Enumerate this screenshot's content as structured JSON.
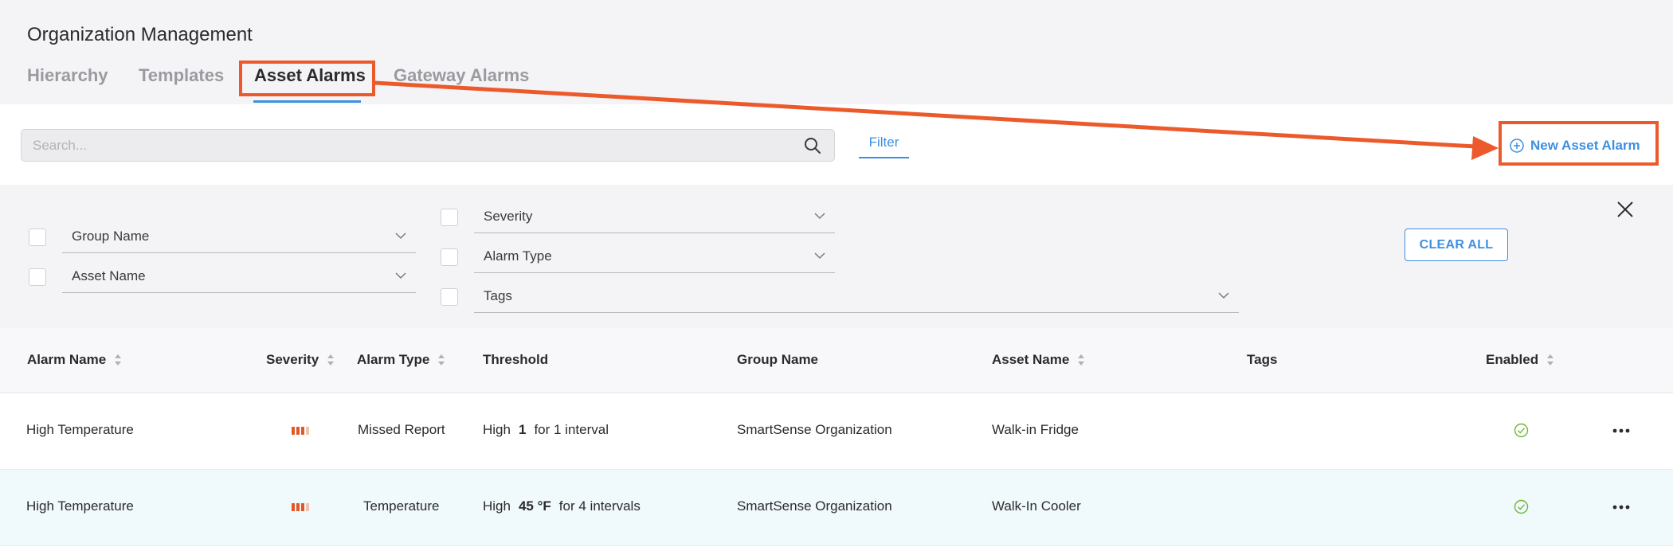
{
  "page": {
    "title": "Organization Management"
  },
  "tabs": [
    {
      "label": "Hierarchy",
      "active": false
    },
    {
      "label": "Templates",
      "active": false
    },
    {
      "label": "Asset Alarms",
      "active": true
    },
    {
      "label": "Gateway Alarms",
      "active": false
    }
  ],
  "toolbar": {
    "search_placeholder": "Search...",
    "filter_label": "Filter",
    "new_button_label": "New Asset Alarm"
  },
  "filters": {
    "group_name": "Group Name",
    "asset_name": "Asset Name",
    "severity": "Severity",
    "alarm_type": "Alarm Type",
    "tags": "Tags",
    "clear_all": "CLEAR ALL"
  },
  "table": {
    "columns": {
      "alarm_name": "Alarm Name",
      "severity": "Severity",
      "alarm_type": "Alarm Type",
      "threshold": "Threshold",
      "group_name": "Group Name",
      "asset_name": "Asset Name",
      "tags": "Tags",
      "enabled": "Enabled"
    },
    "rows": [
      {
        "alarm_name": "High Temperature",
        "severity_level": "high",
        "alarm_type": "Missed Report",
        "threshold_dir": "High",
        "threshold_value": "1",
        "threshold_rest": "for 1 interval",
        "group_name": "SmartSense Organization",
        "asset_name": "Walk-in Fridge",
        "tags": "",
        "enabled": true
      },
      {
        "alarm_name": "High Temperature",
        "severity_level": "high",
        "alarm_type": "Temperature",
        "threshold_dir": "High",
        "threshold_value": "45 °F",
        "threshold_rest": "for 4 intervals",
        "group_name": "SmartSense Organization",
        "asset_name": "Walk-In Cooler",
        "tags": "",
        "enabled": true
      }
    ]
  },
  "colors": {
    "accent": "#3e8fe0",
    "severity_high": "#e0572a",
    "enabled_check": "#6fb63a",
    "annotation": "#ec5a2c"
  },
  "icons": [
    "search-icon",
    "plus-circle-icon",
    "chevron-down-icon",
    "close-icon",
    "sort-icon",
    "severity-high-icon",
    "check-circle-icon",
    "more-icon"
  ]
}
